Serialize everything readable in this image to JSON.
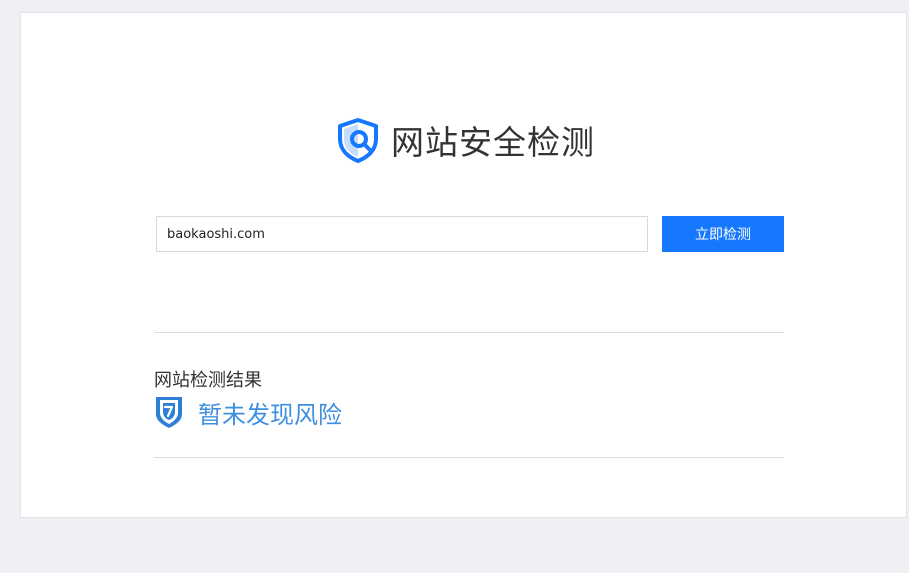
{
  "brand": {
    "title": "网站安全检测",
    "icon": "shield-search-icon",
    "accent_color": "#1677ff"
  },
  "search": {
    "value": "baokaoshi.com",
    "button_label": "立即检测"
  },
  "result": {
    "heading": "网站检测结果",
    "status_text": "暂未发现风险",
    "status_icon": "shield-check-icon",
    "status_color": "#3f8fe0"
  }
}
